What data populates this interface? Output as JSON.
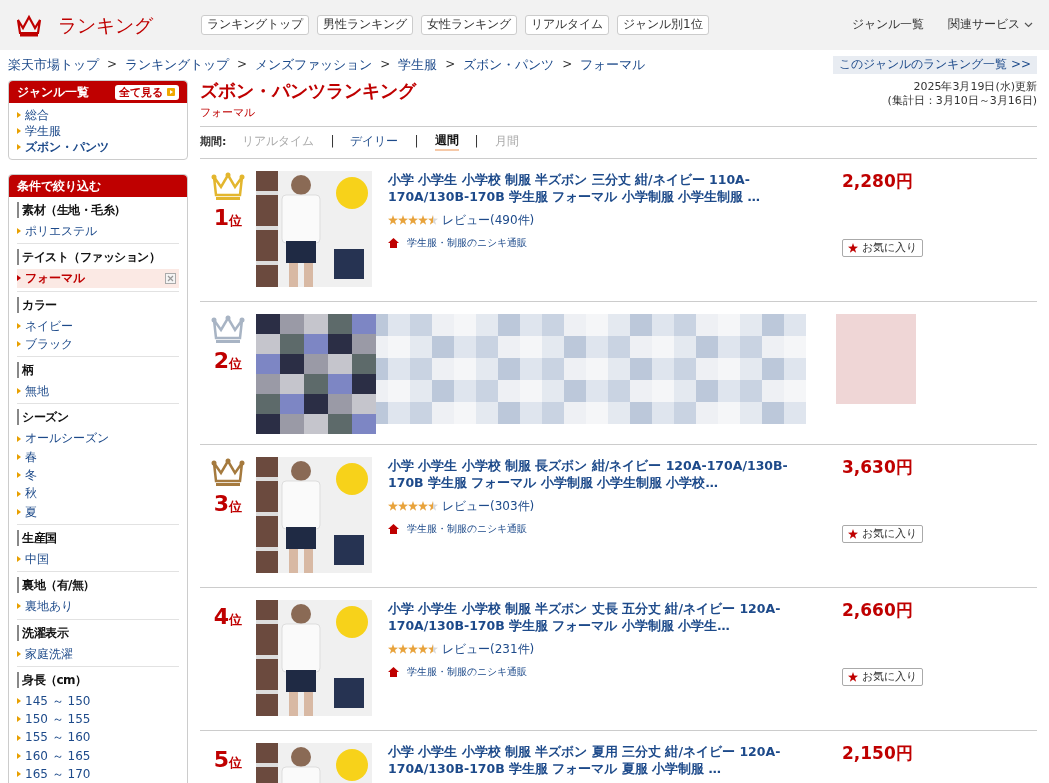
{
  "header": {
    "logo": "ランキング",
    "nav_buttons": [
      "ランキングトップ",
      "男性ランキング",
      "女性ランキング",
      "リアルタイム",
      "ジャンル別1位"
    ],
    "links": [
      {
        "label": "ジャンル一覧",
        "dropdown": false
      },
      {
        "label": "関連サービス",
        "dropdown": true
      }
    ]
  },
  "breadcrumb": [
    "楽天市場トップ",
    "ランキングトップ",
    "メンズファッション",
    "学生服",
    "ズボン・パンツ",
    "フォーマル"
  ],
  "breadcrumb_separator": ">",
  "genre_list_link": "このジャンルのランキング一覧 >>",
  "genre_panel": {
    "title": "ジャンル一覧",
    "see_all": "全て見る",
    "items": [
      {
        "label": "総合",
        "selected": false
      },
      {
        "label": "学生服",
        "selected": false
      },
      {
        "label": "ズボン・パンツ",
        "selected": true
      }
    ]
  },
  "filter_panel": {
    "title": "条件で絞り込む",
    "groups": [
      {
        "heading": "素材（生地・毛糸）",
        "items": [
          {
            "label": "ポリエステル",
            "selected": false
          }
        ]
      },
      {
        "heading": "テイスト（ファッション）",
        "items": [
          {
            "label": "フォーマル",
            "selected": true
          }
        ]
      },
      {
        "heading": "カラー",
        "items": [
          {
            "label": "ネイビー",
            "selected": false
          },
          {
            "label": "ブラック",
            "selected": false
          }
        ]
      },
      {
        "heading": "柄",
        "items": [
          {
            "label": "無地",
            "selected": false
          }
        ]
      },
      {
        "heading": "シーズン",
        "items": [
          {
            "label": "オールシーズン",
            "selected": false
          },
          {
            "label": "春",
            "selected": false
          },
          {
            "label": "冬",
            "selected": false
          },
          {
            "label": "秋",
            "selected": false
          },
          {
            "label": "夏",
            "selected": false
          }
        ]
      },
      {
        "heading": "生産国",
        "items": [
          {
            "label": "中国",
            "selected": false
          }
        ]
      },
      {
        "heading": "裏地（有/無）",
        "items": [
          {
            "label": "裏地あり",
            "selected": false
          }
        ]
      },
      {
        "heading": "洗濯表示",
        "items": [
          {
            "label": "家庭洗濯",
            "selected": false
          }
        ]
      },
      {
        "heading": "身長（cm）",
        "items": [
          {
            "label": "145 ～ 150",
            "selected": false
          },
          {
            "label": "150 ～ 155",
            "selected": false
          },
          {
            "label": "155 ～ 160",
            "selected": false
          },
          {
            "label": "160 ～ 165",
            "selected": false
          },
          {
            "label": "165 ～ 170",
            "selected": false
          }
        ]
      }
    ]
  },
  "page_title": "ズボン・パンツランキング",
  "subtitle": "フォーマル",
  "updated": "2025年3月19日(水)更新",
  "period_note": "(集計日：3月10日～3月16日)",
  "period": {
    "label": "期間:",
    "separator": "|",
    "options": [
      {
        "label": "リアルタイム",
        "selected": false,
        "disabled": true
      },
      {
        "label": "デイリー",
        "selected": false,
        "disabled": false
      },
      {
        "label": "週間",
        "selected": true,
        "disabled": false
      },
      {
        "label": "月間",
        "selected": false,
        "disabled": true
      }
    ]
  },
  "items": [
    {
      "kind": "product",
      "rank": "1",
      "unit": "位",
      "color": "#e3b62e",
      "title": "小学 小学生 小学校 制服 半ズボン 三分丈 紺/ネイビー 110A-170A/130B-170B 学生服 フォーマル 小学制服 小学生制服 …",
      "price": "2,280円",
      "stars": 4.5,
      "reviews": "レビュー(490件)",
      "shop": "学生服・制服のニシキ通販",
      "favorite": "お気に入り"
    },
    {
      "kind": "blurred",
      "rank": "2",
      "unit": "位",
      "color": "#a8b4c4"
    },
    {
      "kind": "product",
      "rank": "3",
      "unit": "位",
      "color": "#a57a3e",
      "title": "小学 小学生 小学校 制服 長ズボン 紺/ネイビー 120A-170A/130B-170B 学生服 フォーマル 小学制服 小学生制服 小学校…",
      "price": "3,630円",
      "stars": 4.5,
      "reviews": "レビュー(303件)",
      "shop": "学生服・制服のニシキ通販",
      "favorite": "お気に入り"
    },
    {
      "kind": "product",
      "rank": "4",
      "unit": "位",
      "title": "小学 小学生 小学校 制服 半ズボン 丈長 五分丈 紺/ネイビー 120A-170A/130B-170B 学生服 フォーマル 小学制服 小学生…",
      "price": "2,660円",
      "stars": 4.5,
      "reviews": "レビュー(231件)",
      "shop": "学生服・制服のニシキ通販",
      "favorite": "お気に入り"
    },
    {
      "kind": "product",
      "rank": "5",
      "unit": "位",
      "title": "小学 小学生 小学校 制服 半ズボン 夏用 三分丈 紺/ネイビー 120A-170A/130B-170B 学生服 フォーマル 夏服 小学制服 …",
      "price": "2,150円"
    }
  ]
}
